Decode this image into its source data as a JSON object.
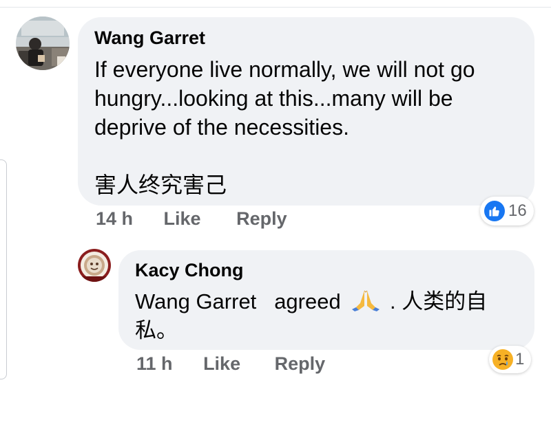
{
  "comments": [
    {
      "author": "Wang Garret",
      "text_lines": [
        "If everyone live normally, we will not go",
        "hungry...looking at this...many will be",
        "deprive of the necessities."
      ],
      "text_cjk": "害人终究害己",
      "time": "14 h",
      "like_label": "Like",
      "reply_label": "Reply",
      "reaction": {
        "icon": "like-icon",
        "count": "16",
        "color": "#1877f2"
      }
    },
    {
      "author": "Kacy Chong",
      "mention": "Wang Garret",
      "text_after_mention": "agreed",
      "text_after_emoji": ". 人类的自",
      "text_line2": "私。",
      "emoji": "folded-hands-emoji",
      "time": "11 h",
      "like_label": "Like",
      "reply_label": "Reply",
      "reaction": {
        "icon": "sad-face-icon",
        "count": "1",
        "color": "#f7b125"
      }
    }
  ],
  "colors": {
    "bubble": "#f0f2f5",
    "meta_text": "#65676b",
    "body_text": "#050505"
  }
}
